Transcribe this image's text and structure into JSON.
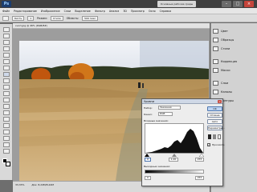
{
  "app": {
    "logo": "Ps",
    "workspace_button": "Основные рабочие среды",
    "window_controls": {
      "minimize": "–",
      "maximize": "□",
      "close": "×"
    }
  },
  "menu": [
    "Файл",
    "Редактирование",
    "Изображение",
    "Слои",
    "Выделение",
    "Фильтр",
    "Анализ",
    "3D",
    "Просмотр",
    "Окно",
    "Справка"
  ],
  "options_bar": {
    "tool_preset": "Кисть",
    "brush_size": "1",
    "mode_label": "Режим:",
    "mode_value": "Стили",
    "opacity_label": "Область:",
    "opacity_value": "500 пикс"
  },
  "document": {
    "tab_title": "кноп.jpg @ 46% (RGB/8#)",
    "status": "33,33%",
    "doc_info": "Док: 8,24M/8,24M"
  },
  "panels": {
    "items": [
      {
        "label": "Цвет",
        "icon": "color-swatch-icon"
      },
      {
        "label": "Образцы",
        "icon": "swatches-icon"
      },
      {
        "label": "Стили",
        "icon": "styles-icon"
      },
      {
        "label": "Коррекция",
        "icon": "adjustments-icon"
      },
      {
        "label": "Маски",
        "icon": "masks-icon"
      },
      {
        "label": "Слои",
        "icon": "layers-icon"
      },
      {
        "label": "Каналы",
        "icon": "channels-icon"
      },
      {
        "label": "Контуры",
        "icon": "paths-icon"
      }
    ]
  },
  "levels_dialog": {
    "title": "Уровни",
    "close_label": "×",
    "preset_label": "Набор:",
    "preset_value": "Заказная",
    "channel_label": "Канал:",
    "channel_value": "RGB",
    "input_label": "Входные значения:",
    "input_black": "0",
    "input_gamma": "1,00",
    "input_white": "255",
    "output_label": "Выходные значения:",
    "output_black": "0",
    "output_white": "255",
    "ok_label": "OK",
    "cancel_label": "Отмена",
    "auto_label": "Авто",
    "options_label": "Параметры...",
    "preview_label": "Просмотр",
    "preview_checked": true
  },
  "colors": {
    "accent": "#4d76b0",
    "histogram": "#111111"
  }
}
